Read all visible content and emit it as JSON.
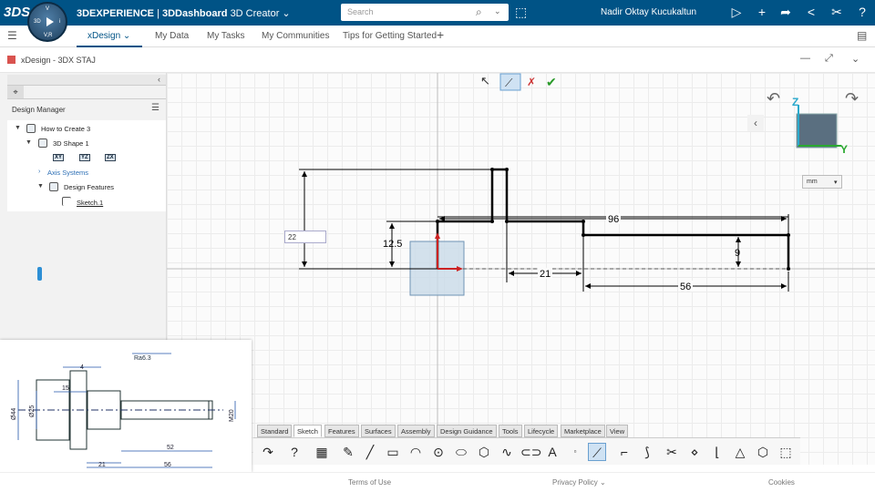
{
  "topbar": {
    "brand_logo": "3DS",
    "brand_app": "3DEXPERIENCE",
    "brand_dashboard": "3DDashboard",
    "brand_role": "3D Creator",
    "brand_chevron": "⌄",
    "compass_quadrants": {
      "n": "V",
      "w": "3D",
      "e": "i",
      "s": "V,R"
    },
    "search": {
      "placeholder": "Search"
    },
    "user": "Nadir Oktay Kucukaltun",
    "icons": [
      "share-icon",
      "plus-icon",
      "forward-icon",
      "share-network-icon",
      "tools-icon",
      "help-icon"
    ]
  },
  "tabs": {
    "items": [
      "xDesign",
      "My Data",
      "My Tasks",
      "My Communities",
      "Tips for Getting Started"
    ],
    "xdesign_chevron": "⌄",
    "add": "+"
  },
  "widget": {
    "title": "xDesign - 3DX STAJ",
    "minimize": "—",
    "expand": "⤢",
    "menu": "⌄"
  },
  "left_panel": {
    "collapse": "‹",
    "header": "Design Manager",
    "tree": {
      "root": "How to Create 3",
      "shape": "3D Shape 1",
      "planes": [
        "XY",
        "YZ",
        "ZX"
      ],
      "axis": "Axis Systems",
      "features": "Design Features",
      "sketch": "Sketch.1"
    }
  },
  "dims": {
    "d96": "96",
    "d12_5": "12.5",
    "d9": "9",
    "d21": "21",
    "d56": "56",
    "input_value": "22"
  },
  "view_cube": {
    "z": "Z",
    "y": "Y",
    "units": "mm"
  },
  "toolbar": {
    "tabs": [
      "Standard",
      "Sketch",
      "Features",
      "Surfaces",
      "Assembly",
      "Design Guidance",
      "Tools",
      "Lifecycle",
      "Marketplace",
      "View"
    ],
    "active_tab": "Sketch"
  },
  "popup": {
    "roughness": "Ra6.3",
    "dims": [
      "4",
      "15",
      "Ø44",
      "Ø25",
      "52",
      "M20",
      "21",
      "56"
    ]
  },
  "footer": {
    "terms": "Terms of Use",
    "privacy": "Privacy Policy ⌄",
    "cookies": "Cookies"
  },
  "colors": {
    "topbar": "#005386",
    "accent": "#2d8fd5",
    "sketch_line": "#000000",
    "origin": "#cc2222"
  }
}
